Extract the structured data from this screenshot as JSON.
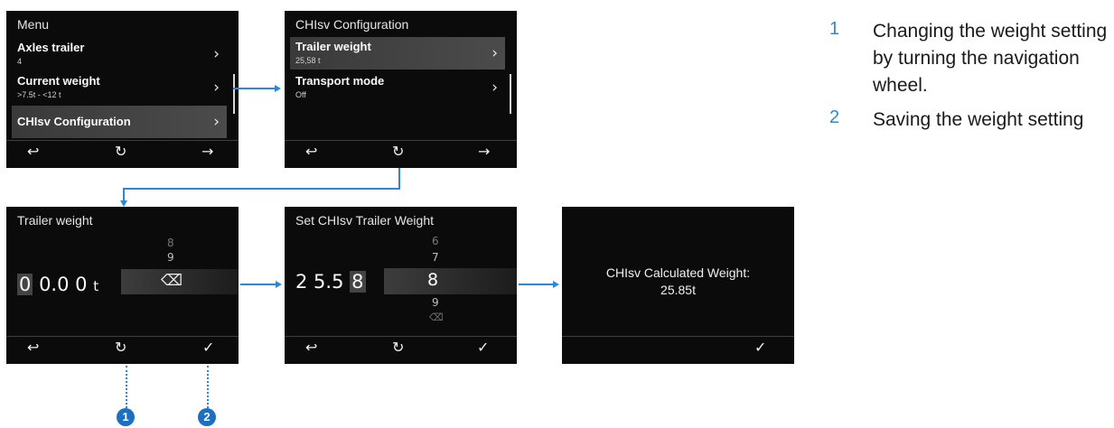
{
  "screen1": {
    "title": "Menu",
    "items": [
      {
        "label": "Axles trailer",
        "sub": "4"
      },
      {
        "label": "Current weight",
        "sub": ">7.5t - <12 t"
      },
      {
        "label": "CHIsv Configuration",
        "sub": ""
      }
    ]
  },
  "screen2": {
    "title": "CHIsv Configuration",
    "items": [
      {
        "label": "Trailer weight",
        "sub": "25,58 t"
      },
      {
        "label": "Transport mode",
        "sub": "Off"
      }
    ]
  },
  "screen3": {
    "title": "Trailer weight",
    "digit_active": "0",
    "digits_rest": "0.0 0",
    "unit": "t",
    "wheel_above": [
      "8",
      "9"
    ]
  },
  "screen4": {
    "title": "Set CHIsv Trailer Weight",
    "digits": "2 5.5",
    "digit_active": "8",
    "wheel_selected": "8",
    "wheel_above": [
      "6",
      "7"
    ],
    "wheel_below": [
      "9"
    ]
  },
  "screen5": {
    "line1": "CHIsv Calculated Weight:",
    "line2": "25.85t"
  },
  "icons": {
    "back": "↩",
    "rotate": "↻",
    "forward": "→",
    "confirm": "✓",
    "chevron": "›",
    "delete": "⌫"
  },
  "badges": [
    "1",
    "2"
  ],
  "legend": [
    {
      "num": "1",
      "text": "Changing the weight setting by turning the navigation wheel."
    },
    {
      "num": "2",
      "text": "Saving the weight setting"
    }
  ],
  "colors": {
    "accent": "#2b88d8",
    "screen_bg": "#0b0b0b"
  }
}
